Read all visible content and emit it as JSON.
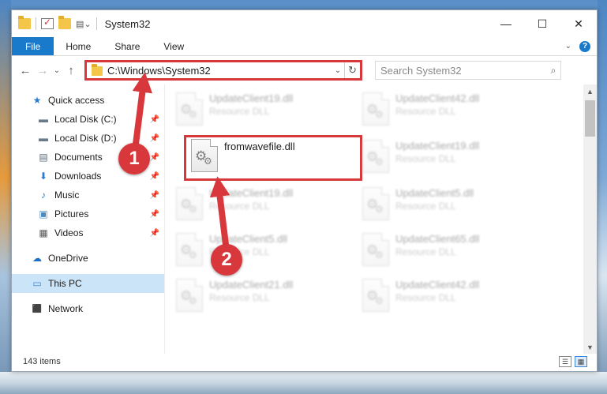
{
  "window": {
    "title": "System32",
    "controls": {
      "minimize": "—",
      "maximize": "☐",
      "close": "✕"
    }
  },
  "ribbon": {
    "tabs": [
      "File",
      "Home",
      "Share",
      "View"
    ],
    "collapse": "⌄",
    "help": "?"
  },
  "nav": {
    "back": "←",
    "forward": "→",
    "recent": "⌄",
    "up": "↑"
  },
  "address": {
    "path": "C:\\Windows\\System32",
    "dropdown": "⌄",
    "refresh": "↻"
  },
  "search": {
    "placeholder": "Search System32",
    "icon": "⌕"
  },
  "sidebar": {
    "items": [
      {
        "label": "Quick access",
        "icon": "star-icon",
        "glyph": "★",
        "color": "#2b7bd1"
      },
      {
        "label": "Local Disk (C:)",
        "icon": "drive-icon",
        "glyph": "▬",
        "color": "#6a7a8a",
        "pinned": true
      },
      {
        "label": "Local Disk (D:)",
        "icon": "drive-icon",
        "glyph": "▬",
        "color": "#6a7a8a",
        "pinned": true
      },
      {
        "label": "Documents",
        "icon": "documents-icon",
        "glyph": "▤",
        "color": "#5a6a7a",
        "pinned": true
      },
      {
        "label": "Downloads",
        "icon": "download-icon",
        "glyph": "⬇",
        "color": "#2b7bd1",
        "pinned": true
      },
      {
        "label": "Music",
        "icon": "music-icon",
        "glyph": "♪",
        "color": "#2b7bd1",
        "pinned": true
      },
      {
        "label": "Pictures",
        "icon": "pictures-icon",
        "glyph": "▣",
        "color": "#4a8ac0",
        "pinned": true
      },
      {
        "label": "Videos",
        "icon": "videos-icon",
        "glyph": "▦",
        "color": "#555555",
        "pinned": true
      },
      {
        "label": "OneDrive",
        "icon": "cloud-icon",
        "glyph": "☁",
        "color": "#1a6fc9"
      },
      {
        "label": "This PC",
        "icon": "computer-icon",
        "glyph": "▭",
        "color": "#3a8ad8"
      },
      {
        "label": "Network",
        "icon": "network-icon",
        "glyph": "⬛",
        "color": "#3a8ad8"
      }
    ],
    "pin_glyph": "📌"
  },
  "files": {
    "focus": {
      "name": "fromwavefile.dll"
    },
    "ghost": [
      {
        "name": "UpdateClient19.dll",
        "type": "Resource DLL"
      },
      {
        "name": "UpdateClient42.dll",
        "type": "Resource DLL"
      },
      {
        "name": "UpdateClient19.dll",
        "type": "Resource DLL"
      },
      {
        "name": "UpdateClient19.dll",
        "type": "Resource DLL"
      },
      {
        "name": "UpdateClient5.dll",
        "type": "Resource DLL"
      },
      {
        "name": "UpdateClient5.dll",
        "type": "Resource DLL"
      },
      {
        "name": "UpdateClient65.dll",
        "type": "Resource DLL"
      },
      {
        "name": "UpdateClient21.dll",
        "type": "Resource DLL"
      },
      {
        "name": "UpdateClient42.dll",
        "type": "Resource DLL"
      }
    ]
  },
  "status": {
    "count": "143 items"
  },
  "annotations": {
    "step1": "1",
    "step2": "2",
    "color": "#d8383b"
  }
}
